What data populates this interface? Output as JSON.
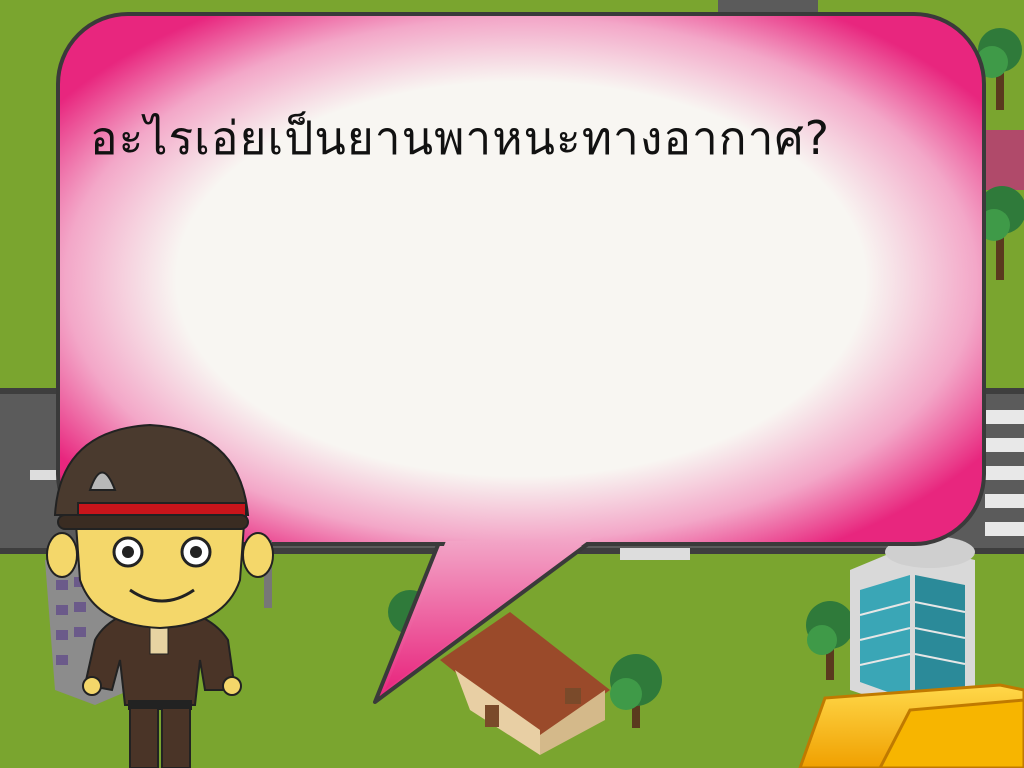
{
  "slide": {
    "question": "อะไรเอ่ยเป็นยานพาหนะทางอากาศ?"
  },
  "colors": {
    "grass": "#7aa52f",
    "road": "#5b5b5b",
    "bubble_edge": "#e8267e",
    "bubble_center": "#f8f6f2",
    "cap": "#4a3a2e",
    "cap_band": "#c8151b",
    "answer_button": "#f7b500"
  },
  "icons": [
    "police-officer-icon",
    "house-icon",
    "tree-icon",
    "building-icon",
    "folder-icon"
  ]
}
